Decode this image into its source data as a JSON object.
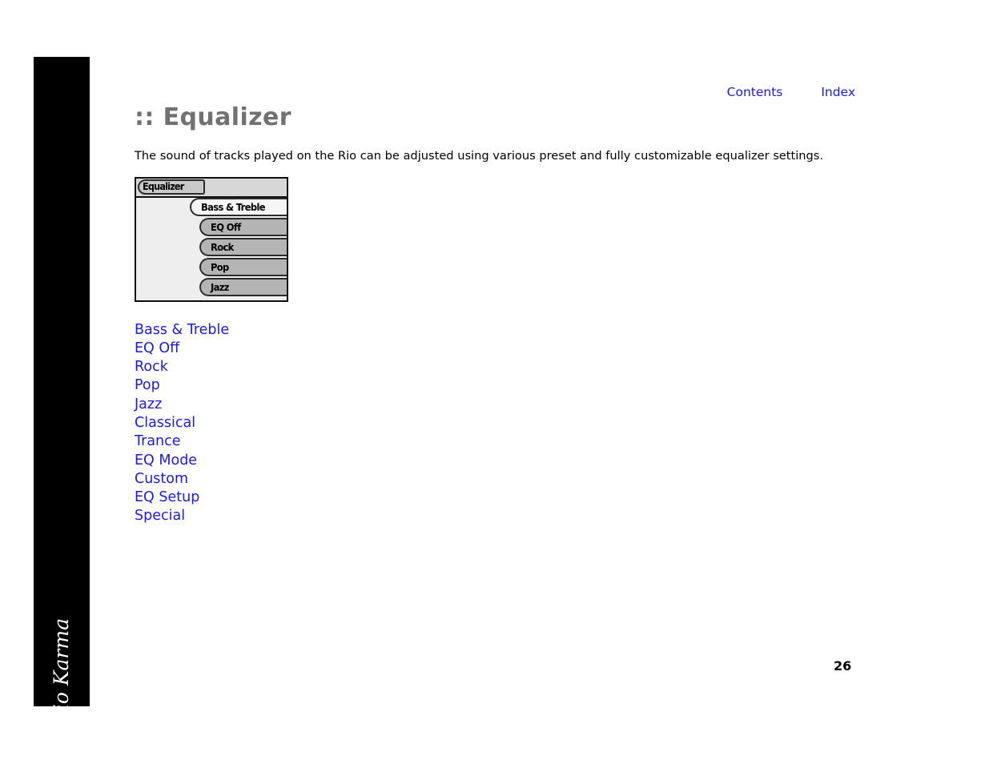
{
  "sidebar": {
    "brand": "Rio Karma"
  },
  "topnav": {
    "links": [
      {
        "label": "Contents"
      },
      {
        "label": "Index"
      }
    ]
  },
  "main": {
    "title": ":: Equalizer",
    "intro": "The sound of tracks played on the Rio can be adjusted using various preset and fully customizable equalizer settings."
  },
  "device_screen": {
    "title": "Equalizer",
    "rows": [
      {
        "label": "Bass & Treble",
        "selected": true
      },
      {
        "label": "EQ Off",
        "selected": false
      },
      {
        "label": "Rock",
        "selected": false
      },
      {
        "label": "Pop",
        "selected": false
      },
      {
        "label": "Jazz",
        "selected": false
      }
    ]
  },
  "links": [
    {
      "label": "Bass & Treble"
    },
    {
      "label": "EQ Off"
    },
    {
      "label": "Rock"
    },
    {
      "label": "Pop"
    },
    {
      "label": "Jazz"
    },
    {
      "label": "Classical"
    },
    {
      "label": "Trance"
    },
    {
      "label": "EQ Mode"
    },
    {
      "label": "Custom"
    },
    {
      "label": "EQ Setup"
    },
    {
      "label": "Special"
    }
  ],
  "footer": {
    "page_number": "26"
  },
  "colors": {
    "link": "#1a1aee",
    "heading": "#717171",
    "sidebar": "#000000",
    "lcd_background": "#eeeeee",
    "lcd_row": "#b4b4b4",
    "lcd_row_selected": "#f6f6f6"
  }
}
